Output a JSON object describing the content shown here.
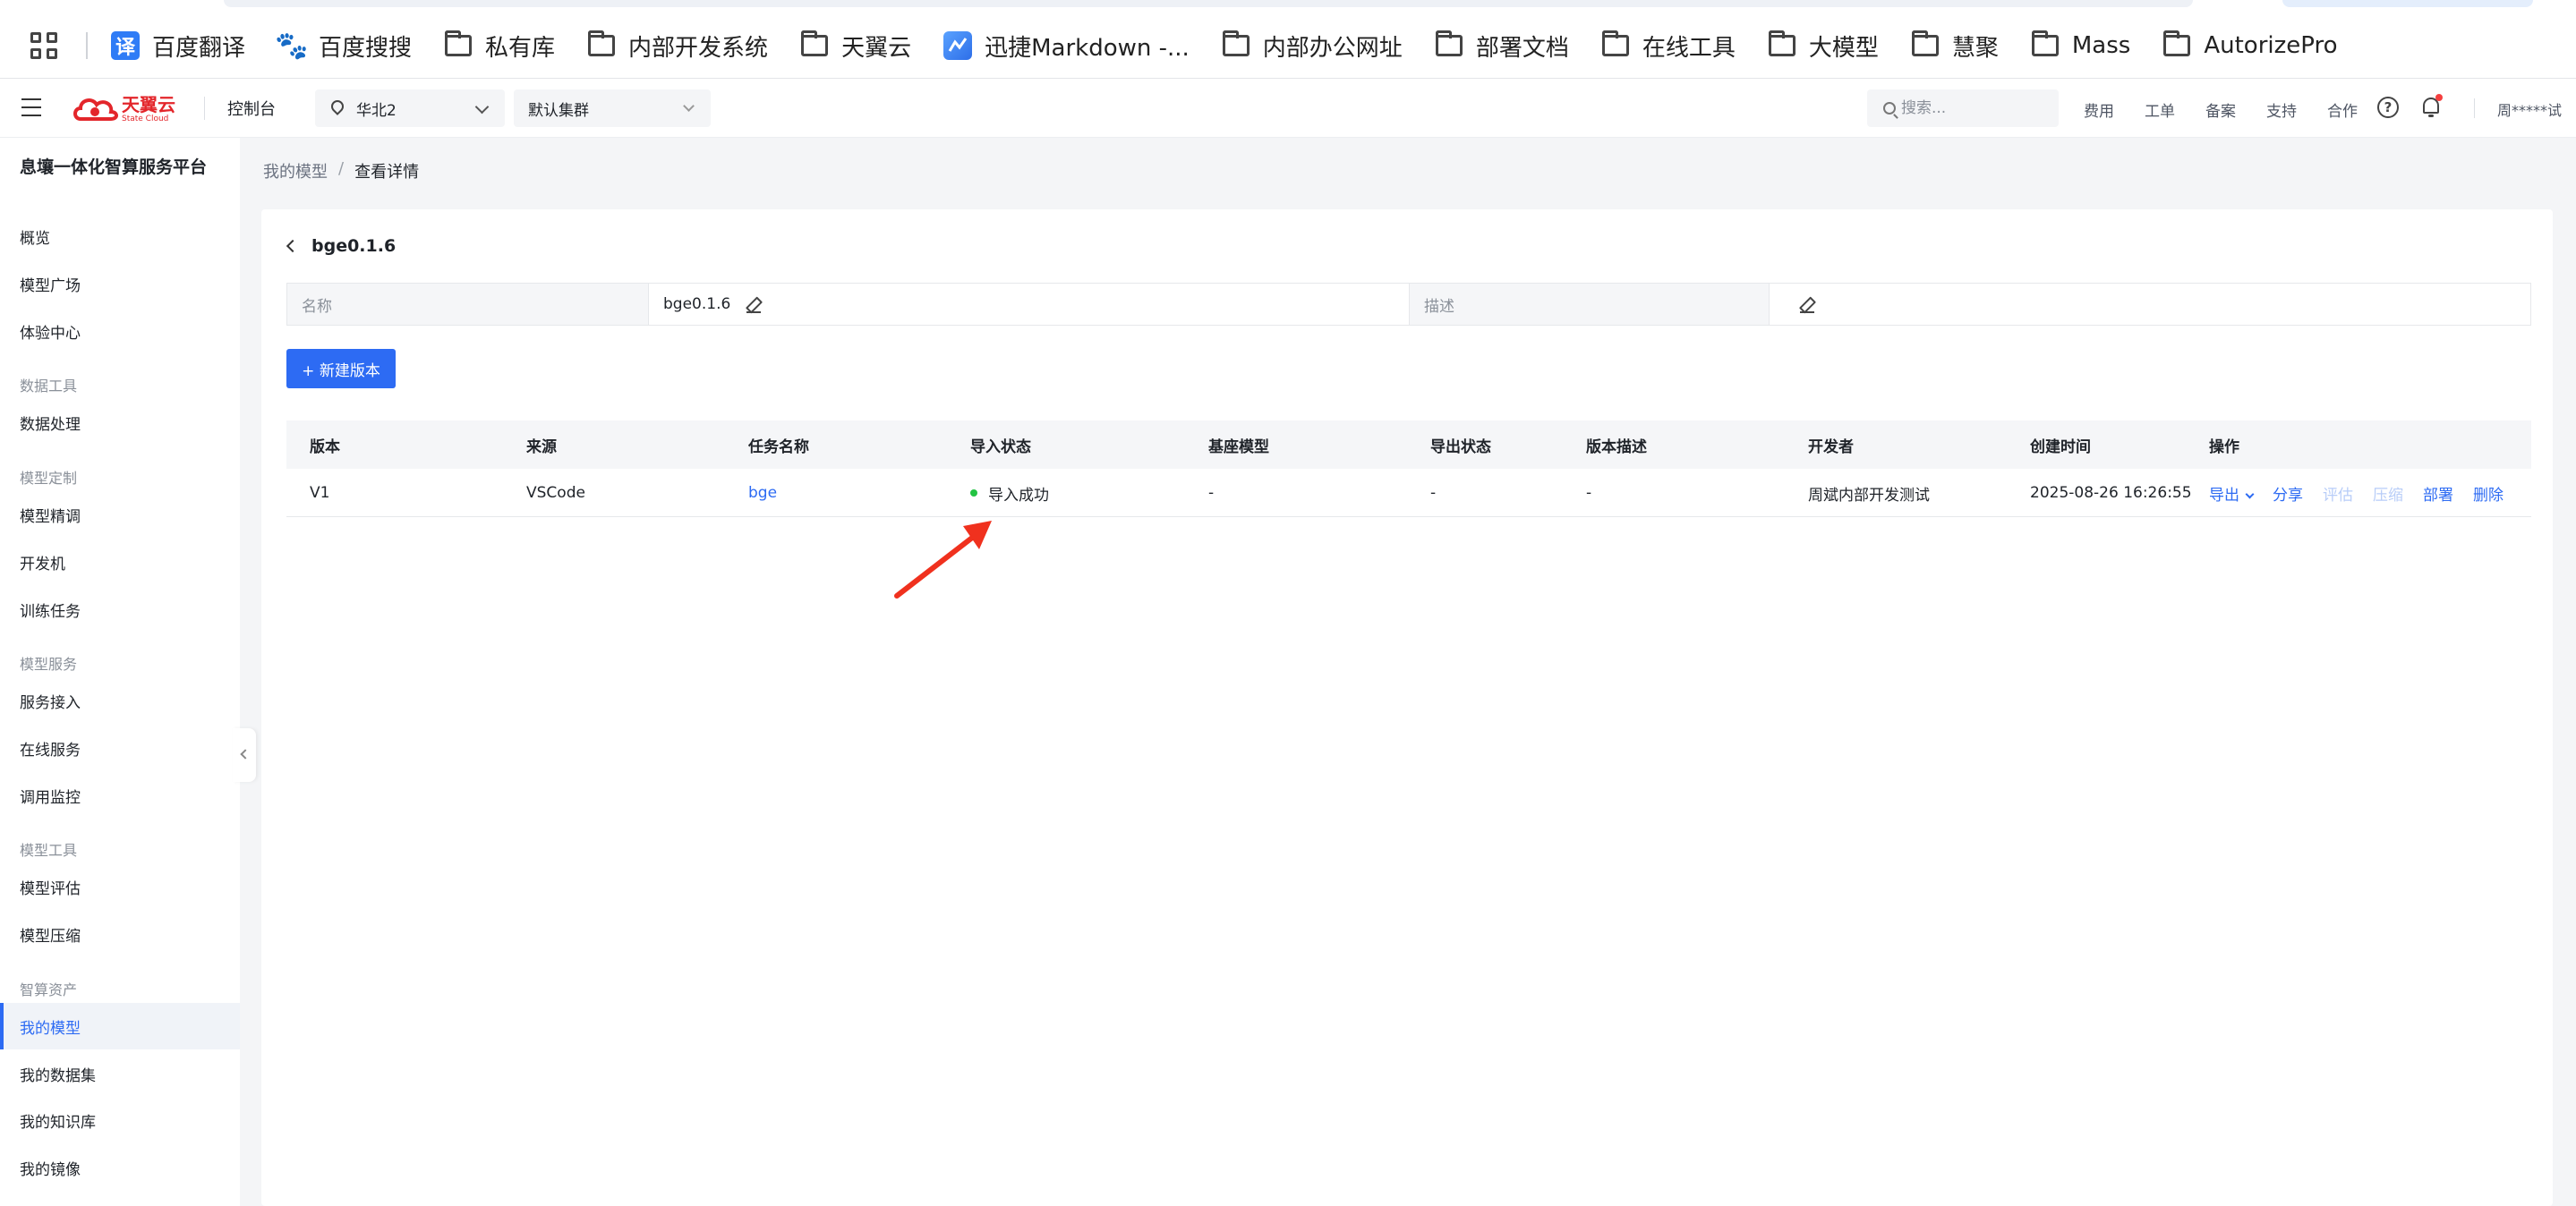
{
  "bookmarks": {
    "items": [
      {
        "label": "百度翻译",
        "icon": "fanyi-icon"
      },
      {
        "label": "百度搜搜",
        "icon": "baidu-paw-icon"
      },
      {
        "label": "私有库",
        "icon": "folder-icon"
      },
      {
        "label": "内部开发系统",
        "icon": "folder-icon"
      },
      {
        "label": "天翼云",
        "icon": "folder-icon"
      },
      {
        "label": "迅捷Markdown -...",
        "icon": "markdown-icon"
      },
      {
        "label": "内部办公网址",
        "icon": "folder-icon"
      },
      {
        "label": "部署文档",
        "icon": "folder-icon"
      },
      {
        "label": "在线工具",
        "icon": "folder-icon"
      },
      {
        "label": "大模型",
        "icon": "folder-icon"
      },
      {
        "label": "慧聚",
        "icon": "folder-icon"
      },
      {
        "label": "Mass",
        "icon": "folder-icon"
      },
      {
        "label": "AutorizePro",
        "icon": "folder-icon"
      }
    ],
    "fanyi_glyph": "译",
    "baidu_glyph": "🐾"
  },
  "header": {
    "logo_cn": "天翼云",
    "logo_en": "State Cloud",
    "console": "控制台",
    "region": "华北2",
    "cluster": "默认集群",
    "search_placeholder": "搜索...",
    "links": [
      "费用",
      "工单",
      "备案",
      "支持",
      "合作"
    ],
    "help_glyph": "?",
    "user": "周*****试"
  },
  "sidebar": {
    "platform": "息壤一体化智算服务平台",
    "items": [
      {
        "label": "概览",
        "type": "item"
      },
      {
        "label": "模型广场",
        "type": "item"
      },
      {
        "label": "体验中心",
        "type": "item"
      },
      {
        "label": "数据工具",
        "type": "group"
      },
      {
        "label": "数据处理",
        "type": "item"
      },
      {
        "label": "模型定制",
        "type": "group"
      },
      {
        "label": "模型精调",
        "type": "item"
      },
      {
        "label": "开发机",
        "type": "item"
      },
      {
        "label": "训练任务",
        "type": "item"
      },
      {
        "label": "模型服务",
        "type": "group"
      },
      {
        "label": "服务接入",
        "type": "item"
      },
      {
        "label": "在线服务",
        "type": "item"
      },
      {
        "label": "调用监控",
        "type": "item"
      },
      {
        "label": "模型工具",
        "type": "group"
      },
      {
        "label": "模型评估",
        "type": "item"
      },
      {
        "label": "模型压缩",
        "type": "item"
      },
      {
        "label": "智算资产",
        "type": "group"
      },
      {
        "label": "我的模型",
        "type": "item",
        "active": true
      },
      {
        "label": "我的数据集",
        "type": "item"
      },
      {
        "label": "我的知识库",
        "type": "item"
      },
      {
        "label": "我的镜像",
        "type": "item"
      }
    ]
  },
  "breadcrumb": {
    "parent": "我的模型",
    "separator": "/",
    "current": "查看详情"
  },
  "detail": {
    "title": "bge0.1.6",
    "name_label": "名称",
    "name_value": "bge0.1.6",
    "desc_label": "描述",
    "desc_value": ""
  },
  "new_version_button": "+ 新建版本",
  "table": {
    "headers": [
      "版本",
      "来源",
      "任务名称",
      "导入状态",
      "基座模型",
      "导出状态",
      "版本描述",
      "开发者",
      "创建时间",
      "操作"
    ],
    "rows": [
      {
        "version": "V1",
        "source": "VSCode",
        "task": "bge",
        "import_status": "导入成功",
        "base_model": "-",
        "export_status": "-",
        "version_desc": "-",
        "developer": "周斌内部开发测试",
        "created": "2025-08-26 16:26:55",
        "actions": {
          "export": "导出",
          "share": "分享",
          "evaluate": "评估",
          "compress": "压缩",
          "deploy": "部署",
          "delete": "删除"
        }
      }
    ]
  },
  "colors": {
    "accent": "#2d6bf3",
    "success": "#23c343",
    "annotation": "#f0311e"
  }
}
